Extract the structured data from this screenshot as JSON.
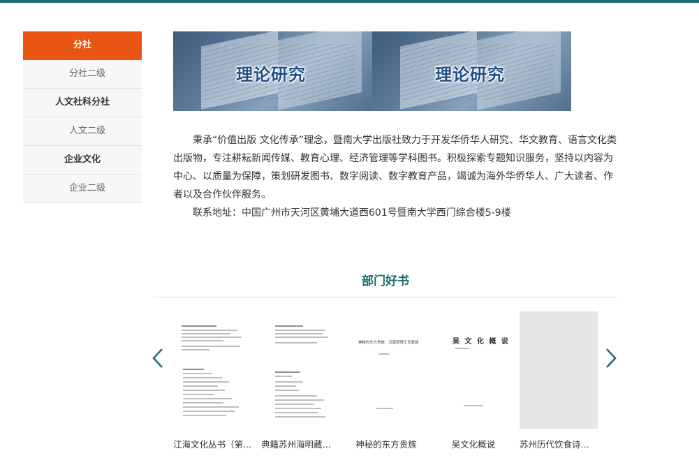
{
  "colors": {
    "accent": "#e95513",
    "brand": "#1f6b72"
  },
  "sidebar": {
    "items": [
      {
        "label": "分社",
        "level": 1,
        "active": true
      },
      {
        "label": "分社二级",
        "level": 2
      },
      {
        "label": "人文社科分社",
        "level": 1
      },
      {
        "label": "人文二级",
        "level": 2
      },
      {
        "label": "企业文化",
        "level": 1
      },
      {
        "label": "企业二级",
        "level": 2
      }
    ]
  },
  "banner": {
    "tiles": [
      "理论研究",
      "理论研究"
    ]
  },
  "intro": {
    "paragraph": "秉承“价值出版 文化传承”理念，暨南大学出版社致力于开发华侨华人研究、华文教育、语言文化类出版物，专注耕耘新闻传媒、教育心理、经济管理等学科图书。积极探索专题知识服务，坚持以内容为中心、以质量为保障，策划研发图书、数字阅读、数字教育产品，竭诚为海外华侨华人、广大读者、作者以及合作伙伴服务。",
    "address": "联系地址：中国广州市天河区黄埔大道西601号暨南大学西门综合楼5-9楼"
  },
  "books_section": {
    "title": "部门好书",
    "prev_icon": "chevron-left-icon",
    "next_icon": "chevron-right-icon",
    "books": [
      {
        "title": "江海文化丛书（第..."
      },
      {
        "title": "典籍苏州海明藏本:..."
      },
      {
        "title": "神秘的东方贵族",
        "cover_text": "神秘的东方贵族：汉唐琅琊王氏家族"
      },
      {
        "title": "吴文化概说",
        "cover_text": "吴 文 化 概 说"
      },
      {
        "title": "苏州历代饮食诗词选"
      }
    ]
  }
}
